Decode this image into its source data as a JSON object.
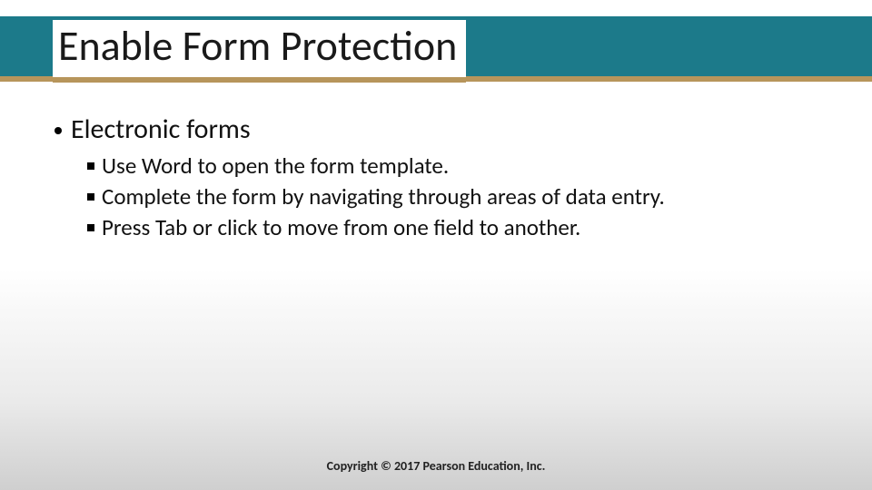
{
  "slide": {
    "title": "Enable Form Protection",
    "bullets": [
      {
        "text": "Electronic forms",
        "children": [
          {
            "text": "Use Word to open the form template."
          },
          {
            "text": "Complete the form by navigating through areas of data entry."
          },
          {
            "text": "Press Tab or click to move from one field to another."
          }
        ]
      }
    ],
    "footer": "Copyright © 2017 Pearson Education, Inc."
  },
  "colors": {
    "header_band": "#1c7a8a",
    "gold_rule": "#b7955b"
  }
}
